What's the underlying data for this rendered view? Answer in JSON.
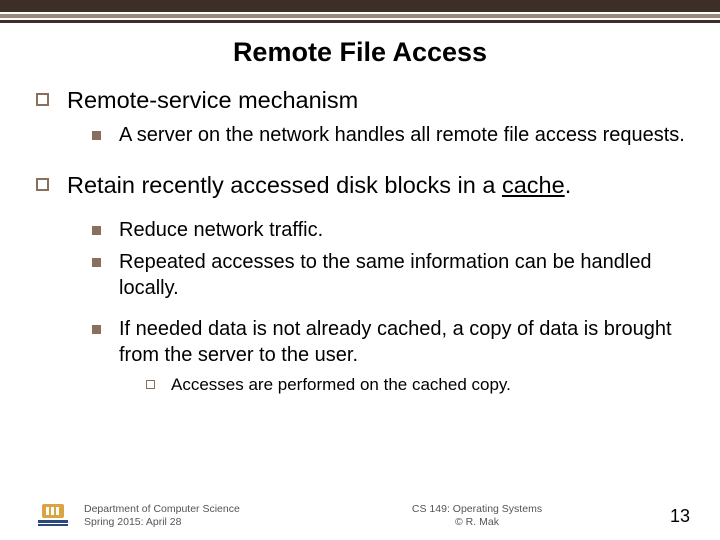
{
  "title": "Remote File Access",
  "bullets": {
    "b1": "Remote-service mechanism",
    "b1_1": "A server on the network handles all remote file access requests.",
    "b2_pre": "Retain recently accessed disk blocks in a ",
    "b2_u": "cache",
    "b2_post": ".",
    "b2_1": "Reduce network traffic.",
    "b2_2": "Repeated accesses to the same information can be handled locally.",
    "b2_3": "If needed data is not already cached, a copy of data is brought from the server to the user.",
    "b2_3_1": "Accesses are performed on the cached copy."
  },
  "footer": {
    "left_l1": "Department of Computer Science",
    "left_l2": "Spring 2015: April 28",
    "mid_l1": "CS 149: Operating Systems",
    "mid_l2": "© R. Mak",
    "page": "13"
  }
}
